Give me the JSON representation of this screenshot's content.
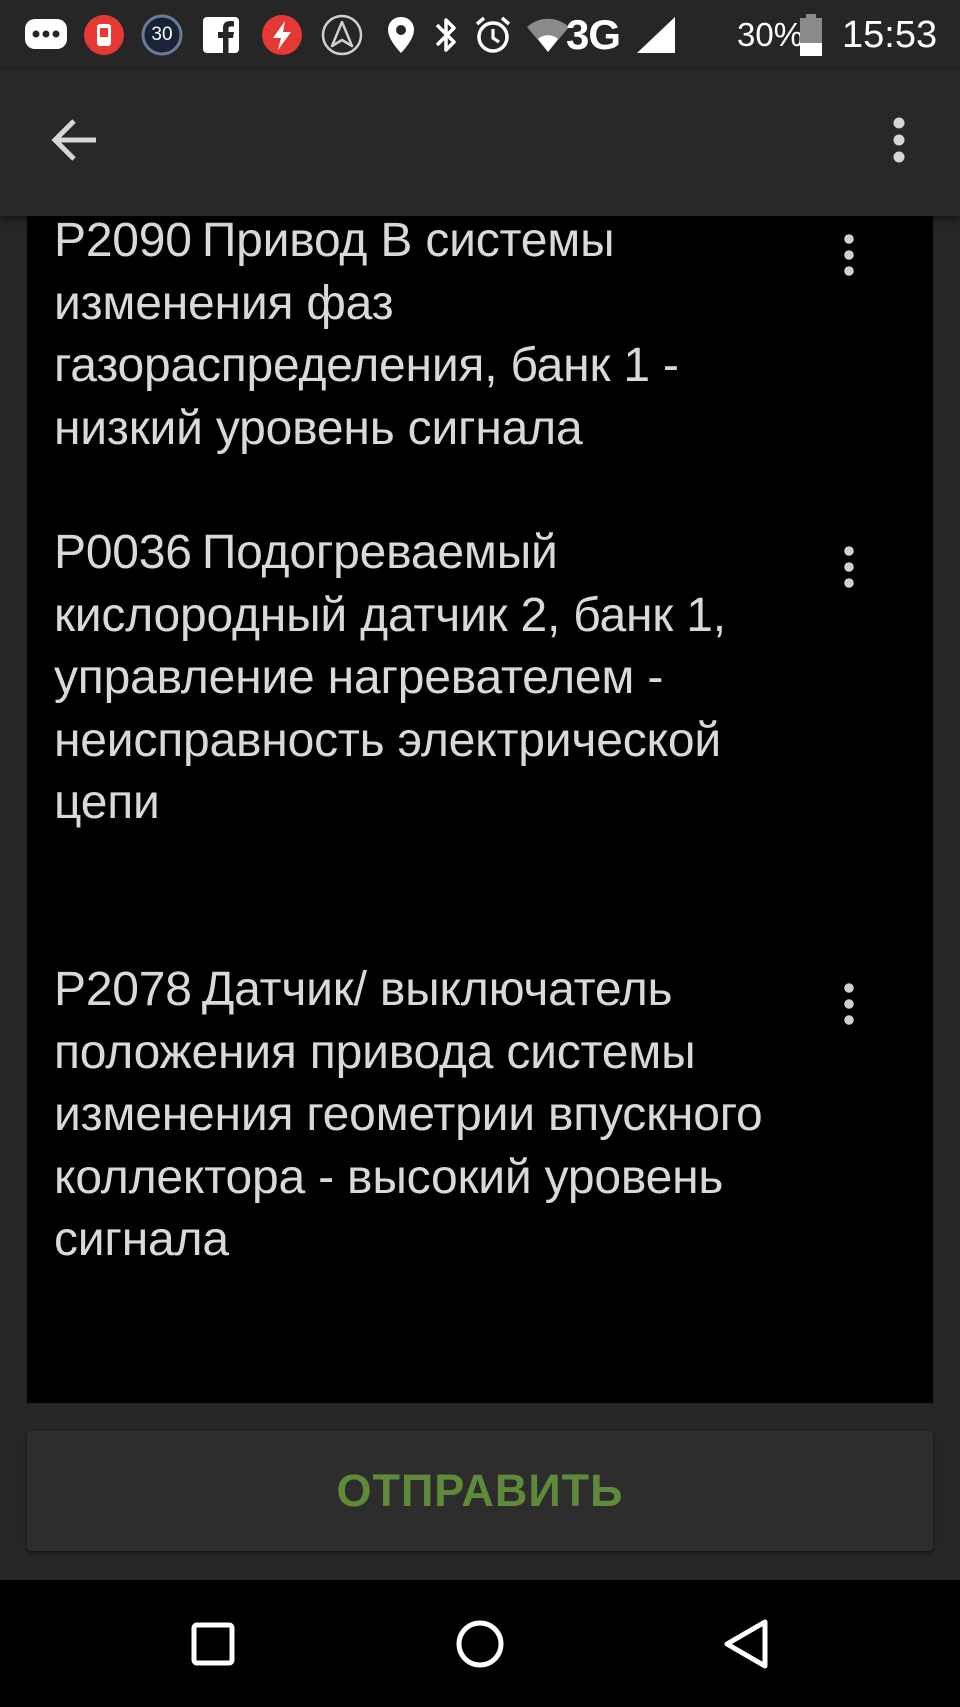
{
  "status_bar": {
    "notification_badge": "30",
    "network": "3G",
    "battery": "30%",
    "time": "15:53",
    "icons": [
      "chat-icon",
      "app-red-icon",
      "badge-30-icon",
      "facebook-icon",
      "flash-app-icon",
      "navigation-app-icon",
      "location-icon",
      "bluetooth-icon",
      "alarm-icon",
      "wifi-icon",
      "signal-icon",
      "battery-icon"
    ]
  },
  "app_bar": {
    "back_icon": "arrow-back-icon",
    "menu_icon": "more-vert-icon"
  },
  "error_codes": [
    {
      "code": "P2090",
      "description": "Привод В системы изменения фаз газораспределения, банк 1 - низкий уровень сигнала"
    },
    {
      "code": "P0036",
      "description": "Подогреваемый кислородный датчик 2, банк 1, управление нагревателем - неисправность электрической цепи"
    },
    {
      "code": "P2078",
      "description": "Датчик/ выключатель положения привода системы изменения геометрии впускного коллектора - высокий уровень сигнала"
    }
  ],
  "send_button": {
    "label": "ОТПРАВИТЬ"
  },
  "nav_bar": {
    "icons": [
      "recent-apps-icon",
      "home-icon",
      "back-icon"
    ]
  },
  "colors": {
    "accent_green": "#5f8a3a",
    "text": "#d9d9d9",
    "app_bar": "#282828",
    "panel": "#000000"
  }
}
